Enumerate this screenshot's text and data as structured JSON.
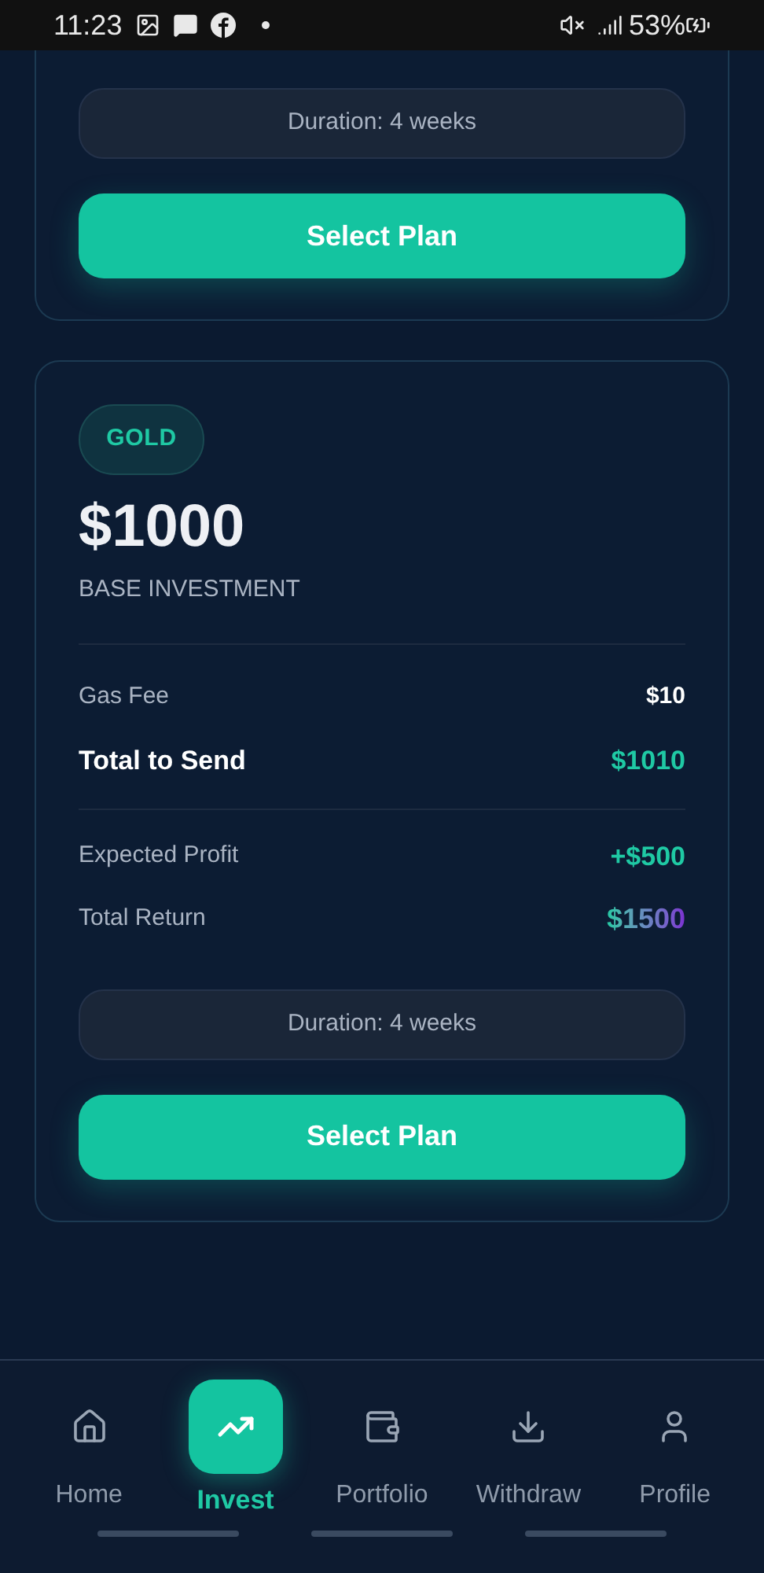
{
  "status_bar": {
    "time": "11:23",
    "battery": "53%"
  },
  "partial_plan": {
    "duration": "Duration: 4 weeks",
    "button": "Select Plan"
  },
  "plan": {
    "tier": "GOLD",
    "amount": "$1000",
    "amount_label": "BASE INVESTMENT",
    "row_groups": [
      [
        {
          "kind": "normal",
          "label": "Gas Fee",
          "value": "$10"
        },
        {
          "kind": "emphasis",
          "label": "Total to Send",
          "value": "$1010"
        }
      ],
      [
        {
          "kind": "accent",
          "label": "Expected Profit",
          "value": "+$500"
        },
        {
          "kind": "gradient",
          "label": "Total Return",
          "value": "$1500"
        }
      ]
    ],
    "duration": "Duration: 4 weeks",
    "button": "Select Plan"
  },
  "nav": [
    {
      "label": "Home",
      "selected": false
    },
    {
      "label": "Invest",
      "selected": true
    },
    {
      "label": "Portfolio",
      "selected": false
    },
    {
      "label": "Withdraw",
      "selected": false
    },
    {
      "label": "Profile",
      "selected": false
    }
  ]
}
